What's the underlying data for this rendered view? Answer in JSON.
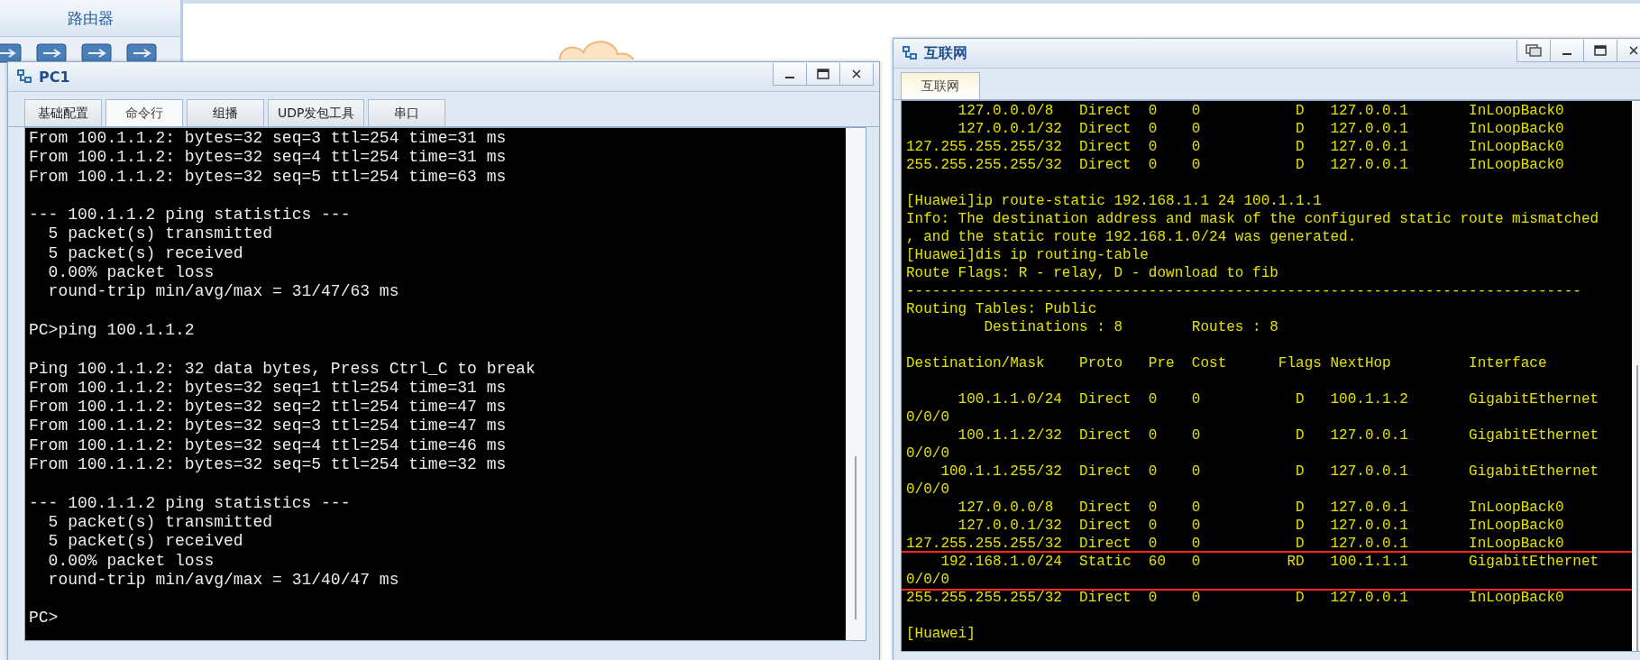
{
  "palette": {
    "title": "路由器"
  },
  "pc_window": {
    "title": "PC1",
    "tabs": [
      {
        "label": "基础配置",
        "selected": false
      },
      {
        "label": "命令行",
        "selected": true
      },
      {
        "label": "组播",
        "selected": false
      },
      {
        "label": "UDP发包工具",
        "selected": false
      },
      {
        "label": "串口",
        "selected": false
      }
    ],
    "terminal": {
      "paragraphs": [
        [
          "From 100.1.1.2: bytes=32 seq=3 ttl=254 time=31 ms",
          "From 100.1.1.2: bytes=32 seq=4 ttl=254 time=31 ms",
          "From 100.1.1.2: bytes=32 seq=5 ttl=254 time=63 ms"
        ],
        [
          "--- 100.1.1.2 ping statistics ---",
          "  5 packet(s) transmitted",
          "  5 packet(s) received",
          "  0.00% packet loss",
          "  round-trip min/avg/max = 31/47/63 ms"
        ],
        [
          "PC>ping 100.1.1.2"
        ],
        [
          "Ping 100.1.1.2: 32 data bytes, Press Ctrl_C to break",
          "From 100.1.1.2: bytes=32 seq=1 ttl=254 time=31 ms",
          "From 100.1.1.2: bytes=32 seq=2 ttl=254 time=47 ms",
          "From 100.1.1.2: bytes=32 seq=3 ttl=254 time=47 ms",
          "From 100.1.1.2: bytes=32 seq=4 ttl=254 time=46 ms",
          "From 100.1.1.2: bytes=32 seq=5 ttl=254 time=32 ms"
        ],
        [
          "--- 100.1.1.2 ping statistics ---",
          "  5 packet(s) transmitted",
          "  5 packet(s) received",
          "  0.00% packet loss",
          "  round-trip min/avg/max = 31/40/47 ms"
        ],
        [
          "PC>"
        ]
      ]
    }
  },
  "internet_window": {
    "title": "互联网",
    "tabs": [
      {
        "label": "互联网",
        "selected": true
      }
    ],
    "terminal": {
      "paragraphs": [
        [
          {
            "text": "      127.0.0.0/8   Direct  0    0           D   127.0.0.1       InLoopBack0",
            "highlighted": false
          },
          {
            "text": "      127.0.0.1/32  Direct  0    0           D   127.0.0.1       InLoopBack0",
            "highlighted": false
          },
          {
            "text": "127.255.255.255/32  Direct  0    0           D   127.0.0.1       InLoopBack0",
            "highlighted": false
          },
          {
            "text": "255.255.255.255/32  Direct  0    0           D   127.0.0.1       InLoopBack0",
            "highlighted": false
          }
        ],
        [
          {
            "text": "[Huawei]ip route-static 192.168.1.1 24 100.1.1.1",
            "highlighted": false
          },
          {
            "text": "Info: The destination address and mask of the configured static route mismatched",
            "highlighted": false
          },
          {
            "text": ", and the static route 192.168.1.0/24 was generated.",
            "highlighted": false
          },
          {
            "text": "[Huawei]dis ip routing-table",
            "highlighted": false
          },
          {
            "text": "Route Flags: R - relay, D - download to fib",
            "highlighted": false
          },
          {
            "text": "------------------------------------------------------------------------------",
            "highlighted": false
          },
          {
            "text": "Routing Tables: Public",
            "highlighted": false
          },
          {
            "text": "         Destinations : 8        Routes : 8",
            "highlighted": false
          }
        ],
        [
          {
            "text": "Destination/Mask    Proto   Pre  Cost      Flags NextHop         Interface",
            "highlighted": false
          }
        ],
        [
          {
            "text": "      100.1.1.0/24  Direct  0    0           D   100.1.1.2       GigabitEthernet",
            "highlighted": false
          },
          {
            "text": "0/0/0",
            "highlighted": false
          },
          {
            "text": "      100.1.1.2/32  Direct  0    0           D   127.0.0.1       GigabitEthernet",
            "highlighted": false
          },
          {
            "text": "0/0/0",
            "highlighted": false
          },
          {
            "text": "    100.1.1.255/32  Direct  0    0           D   127.0.0.1       GigabitEthernet",
            "highlighted": false
          },
          {
            "text": "0/0/0",
            "highlighted": false
          },
          {
            "text": "      127.0.0.0/8   Direct  0    0           D   127.0.0.1       InLoopBack0",
            "highlighted": false
          },
          {
            "text": "      127.0.0.1/32  Direct  0    0           D   127.0.0.1       InLoopBack0",
            "highlighted": false
          },
          {
            "text": "127.255.255.255/32  Direct  0    0           D   127.0.0.1       InLoopBack0",
            "highlighted": false
          },
          {
            "text": "    192.168.1.0/24  Static  60   0          RD   100.1.1.1       GigabitEthernet",
            "highlighted": true
          },
          {
            "text": "0/0/0",
            "highlighted": true
          },
          {
            "text": "255.255.255.255/32  Direct  0    0           D   127.0.0.1       InLoopBack0",
            "highlighted": false
          }
        ],
        [
          {
            "text": "[Huawei]",
            "highlighted": false
          }
        ]
      ]
    }
  }
}
